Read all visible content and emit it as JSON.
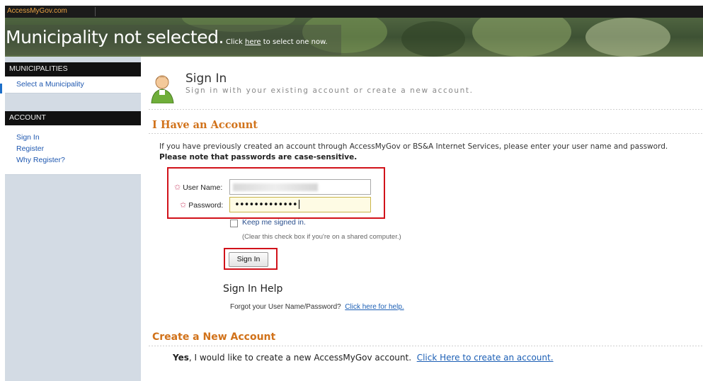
{
  "topbar": {
    "brand": "AccessMyGov.com"
  },
  "banner": {
    "title": "Municipality not selected.",
    "hint_prefix": "Click ",
    "hint_link": "here",
    "hint_suffix": " to select one now."
  },
  "sidebar": {
    "municipalities": {
      "heading": "MUNICIPALITIES",
      "items": [
        {
          "label": "Select a Municipality"
        }
      ]
    },
    "account": {
      "heading": "ACCOUNT",
      "items": [
        {
          "label": "Sign In"
        },
        {
          "label": "Register"
        },
        {
          "label": "Why Register?"
        }
      ]
    }
  },
  "header": {
    "title": "Sign In",
    "subtitle": "Sign in with your existing account or create a new account.",
    "avatar_icon": "user-avatar-icon"
  },
  "have_account": {
    "title": "I Have an Account",
    "description": "If you have previously created an account through AccessMyGov or BS&A Internet Services, please enter your user name and password.",
    "note": "Please note that passwords are case-sensitive."
  },
  "form": {
    "username_label": "User Name:",
    "password_label": "Password:",
    "password_value": "•••••••••••••",
    "required_icon": "star-icon",
    "keep_signed_in_label": "Keep me signed in.",
    "keep_signed_in_note": "(Clear this check box if you're on a shared computer.)",
    "sign_in_button": "Sign In"
  },
  "help": {
    "title": "Sign In Help",
    "text": "Forgot your User Name/Password?",
    "link": "Click here for help."
  },
  "create": {
    "title": "Create a New Account",
    "yes": "Yes",
    "text": ", I would like to create a new AccessMyGov account.",
    "link": "Click Here to create an account."
  },
  "colors": {
    "accent": "#d1721a",
    "link": "#1c5fb5",
    "highlight": "#d1121a",
    "sidebar_bg": "#d3dbe4"
  }
}
